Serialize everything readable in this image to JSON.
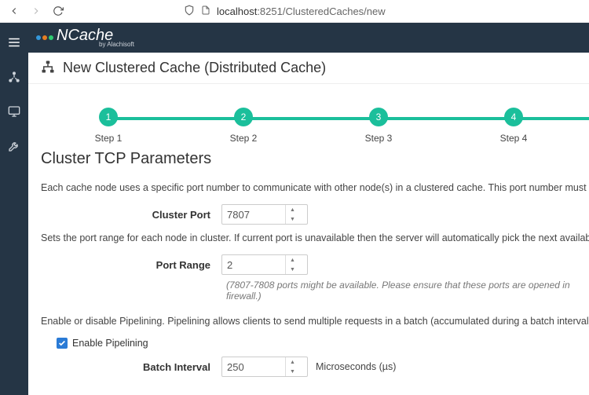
{
  "browser": {
    "url_host": "localhost",
    "url_port": ":8251",
    "url_path": "/ClusteredCaches/new"
  },
  "brand": {
    "name": "NCache",
    "byline": "by Alachisoft"
  },
  "page": {
    "title": "New Clustered Cache (Distributed Cache)",
    "section_title": "Cluster TCP Parameters"
  },
  "steps": [
    {
      "num": "1",
      "label": "Step 1"
    },
    {
      "num": "2",
      "label": "Step 2"
    },
    {
      "num": "3",
      "label": "Step 3"
    },
    {
      "num": "4",
      "label": "Step 4"
    }
  ],
  "text": {
    "desc_cluster_port": "Each cache node uses a specific port number to communicate with other node(s) in a clustered cache. This port number must be unique on every c",
    "desc_port_range": "Sets the port range for each node in cluster. If current port is unavailable then the server will automatically pick the next available port in the pool.",
    "hint_port_range": "(7807-7808 ports might be available. Please ensure that these ports are opened in firewall.)",
    "desc_pipelining": "Enable or disable Pipelining. Pipelining allows clients to send multiple requests in a batch (accumulated during a batch interval) using a single TCP"
  },
  "form": {
    "cluster_port": {
      "label": "Cluster Port",
      "value": "7807"
    },
    "port_range": {
      "label": "Port Range",
      "value": "2"
    },
    "enable_pipelining": {
      "label": "Enable Pipelining",
      "checked": true
    },
    "batch_interval": {
      "label": "Batch Interval",
      "value": "250",
      "unit": "Microseconds (µs)"
    }
  }
}
